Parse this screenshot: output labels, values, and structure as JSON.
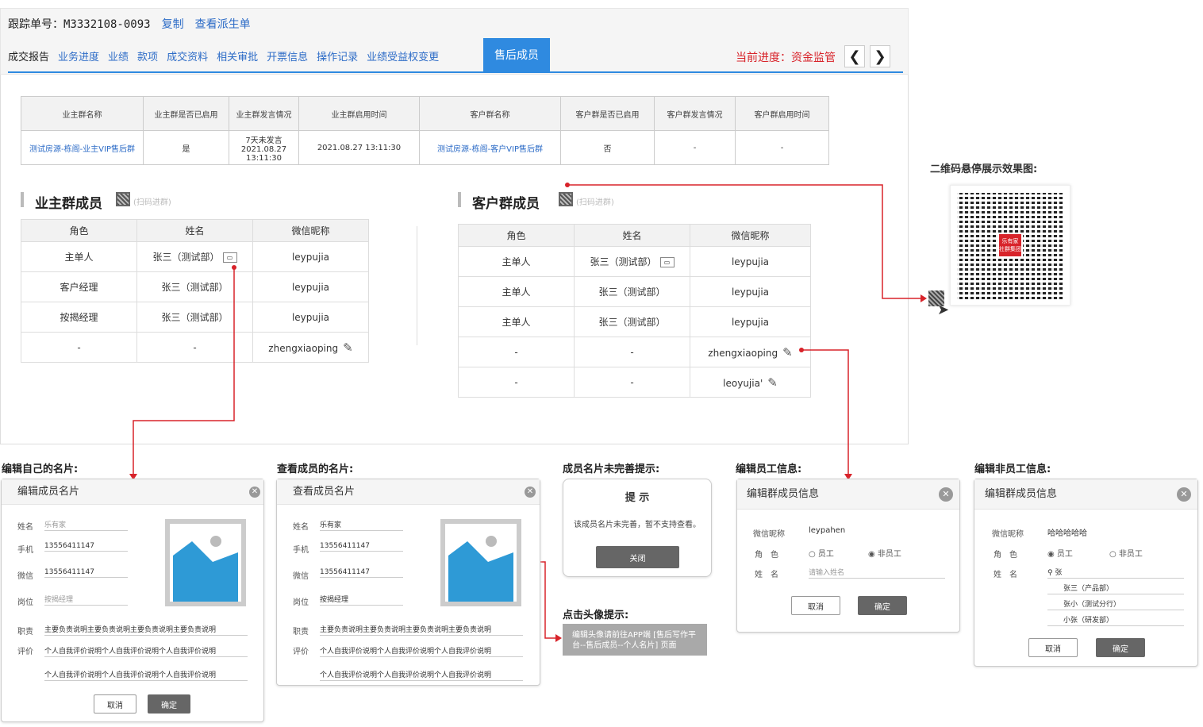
{
  "header": {
    "tracking_label": "跟踪单号：M3332108-0093",
    "copy": "复制",
    "view_order": "查看派生单",
    "progress": "当前进度：资金监管",
    "prev": "❮",
    "next": "❯"
  },
  "tabs": [
    "成交报告",
    "业务进度",
    "业绩",
    "款项",
    "成交资料",
    "相关审批",
    "开票信息",
    "操作记录",
    "业绩受益权变更"
  ],
  "active_tab": "售后成员",
  "group_table": {
    "headers": [
      "业主群名称",
      "业主群是否已启用",
      "业主群发言情况",
      "业主群启用时间",
      "客户群名称",
      "客户群是否已启用",
      "客户群发言情况",
      "客户群启用时间"
    ],
    "row": [
      "测试房源-栋阁-业主VIP售后群",
      "是",
      "7天未发言",
      "2021.08.27 13:11:30",
      "2021.08.27 13:11:30",
      "测试房源-栋阁-客户VIP售后群",
      "否",
      "-",
      "-"
    ]
  },
  "owner": {
    "title": "业主群成员",
    "scan": "(扫码进群)",
    "headers": [
      "角色",
      "姓名",
      "微信昵称"
    ],
    "rows": [
      [
        "主单人",
        "张三（测试部）",
        "leypujia"
      ],
      [
        "客户经理",
        "张三（测试部）",
        "leypujia"
      ],
      [
        "按揭经理",
        "张三（测试部）",
        "leypujia"
      ],
      [
        "-",
        "-",
        "zhengxiaoping"
      ]
    ]
  },
  "client": {
    "title": "客户群成员",
    "scan": "(扫码进群)",
    "headers": [
      "角色",
      "姓名",
      "微信昵称"
    ],
    "rows": [
      [
        "主单人",
        "张三（测试部）",
        "leypujia"
      ],
      [
        "主单人",
        "张三（测试部）",
        "leypujia"
      ],
      [
        "主单人",
        "张三（测试部）",
        "leypujia"
      ],
      [
        "-",
        "-",
        "zhengxiaoping"
      ],
      [
        "-",
        "-",
        "leoyujia'"
      ]
    ]
  },
  "qr_caption": "二维码悬停展示效果图:",
  "qr_center": "乐有家 社群集团",
  "captions": {
    "edit_own": "编辑自己的名片:",
    "view_member": "查看成员的名片:",
    "incomplete": "成员名片未完善提示:",
    "avatar": "点击头像提示:",
    "edit_staff": "编辑员工信息:",
    "edit_nonstaff": "编辑非员工信息:"
  },
  "card_edit": {
    "title": "编辑成员名片",
    "name_l": "姓名",
    "name": "乐有家",
    "phone_l": "手机",
    "phone": "13556411147",
    "wx_l": "微信",
    "wx": "13556411147",
    "pos_l": "岗位",
    "pos": "按揭经理",
    "duty_l": "职责",
    "duty": "主要负责说明主要负责说明主要负责说明主要负责说明",
    "eval_l": "评价",
    "eval1": "个人自我评价说明个人自我评价说明个人自我评价说明",
    "eval2": "个人自我评价说明个人自我评价说明个人自我评价说明",
    "cancel": "取消",
    "ok": "确定"
  },
  "card_view": {
    "title": "查看成员名片",
    "name_l": "姓名",
    "name": "乐有家",
    "phone_l": "手机",
    "phone": "13556411147",
    "wx_l": "微信",
    "wx": "13556411147",
    "pos_l": "岗位",
    "pos": "按揭经理",
    "duty_l": "职责",
    "duty": "主要负责说明主要负责说明主要负责说明主要负责说明",
    "eval_l": "评价",
    "eval1": "个人自我评价说明个人自我评价说明个人自我评价说明",
    "eval2": "个人自我评价说明个人自我评价说明个人自我评价说明"
  },
  "prompt": {
    "title": "提 示",
    "msg": "该成员名片未完善，暂不支持查看。",
    "close": "关闭"
  },
  "avatar_tip": "编辑头像请前往APP端 [售后写作平台--售后成员--个人名片] 页面",
  "staff": {
    "title": "编辑群成员信息",
    "wx_l": "微信昵称",
    "wx": "leypahen",
    "role_l": "角　色",
    "opt1": "员工",
    "opt2": "非员工",
    "name_l": "姓　名",
    "name_ph": "请输入姓名",
    "cancel": "取消",
    "ok": "确定"
  },
  "nonstaff": {
    "title": "编辑群成员信息",
    "wx_l": "微信昵称",
    "wx": "哈哈哈哈哈",
    "role_l": "角　色",
    "opt1": "员工",
    "opt2": "非员工",
    "name_l": "姓　名",
    "query": "张",
    "s1": "张三（产品部）",
    "s2": "张小（测试分行）",
    "s3": "小张（研发部）",
    "cancel": "取消",
    "ok": "确定"
  }
}
